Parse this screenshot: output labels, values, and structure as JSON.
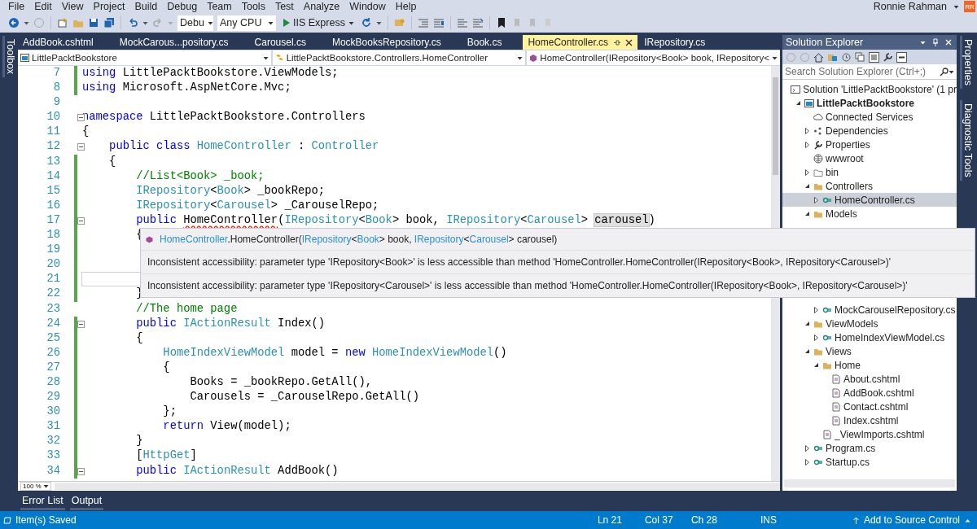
{
  "menu": {
    "items": [
      "File",
      "Edit",
      "View",
      "Project",
      "Build",
      "Debug",
      "Team",
      "Tools",
      "Test",
      "Analyze",
      "Window",
      "Help"
    ],
    "user": "Ronnie Rahman",
    "avatar": "RR"
  },
  "toolbar": {
    "configuration": "Debu",
    "platform": "Any CPU",
    "run": "IIS Express"
  },
  "toolbox_label": "Toolbox",
  "tabs": [
    {
      "label": "AddBook.cshtml",
      "selected": false
    },
    {
      "label": "MockCarous...pository.cs",
      "selected": false
    },
    {
      "label": "Carousel.cs",
      "selected": false
    },
    {
      "label": "MockBooksRepository.cs",
      "selected": false
    },
    {
      "label": "Book.cs",
      "selected": false
    },
    {
      "label": "HomeController.cs",
      "selected": true
    },
    {
      "label": "IRepository.cs",
      "selected": false
    }
  ],
  "navigation": {
    "project": "LittlePacktBookstore",
    "type": "LittlePacktBookstore.Controllers.HomeController",
    "member": "HomeController(IRepository<Book> book, IRepository<"
  },
  "editor": {
    "lines": [
      {
        "number": "7",
        "changed": true,
        "collapsible": false,
        "current": false,
        "tokens": [
          {
            "text": "using ",
            "kind": "keyword"
          },
          {
            "text": "LittlePacktBookstore.ViewModels;",
            "kind": "plain"
          }
        ]
      },
      {
        "number": "8",
        "changed": true,
        "collapsible": false,
        "current": false,
        "tokens": [
          {
            "text": "using ",
            "kind": "keyword"
          },
          {
            "text": "Microsoft.AspNetCore.Mvc;",
            "kind": "plain"
          }
        ]
      },
      {
        "number": "9",
        "changed": false,
        "collapsible": false,
        "current": false
      },
      {
        "number": "10",
        "changed": false,
        "collapsible": true,
        "current": false,
        "tokens": [
          {
            "text": "namespace ",
            "kind": "keyword"
          },
          {
            "text": "LittlePacktBookstore.Controllers",
            "kind": "plain"
          }
        ]
      },
      {
        "number": "11",
        "changed": false,
        "collapsible": false,
        "current": false,
        "tokens": [
          {
            "text": "{",
            "kind": "plain"
          }
        ]
      },
      {
        "number": "12",
        "changed": false,
        "collapsible": true,
        "current": false,
        "tokens": [
          {
            "text": "    public class ",
            "kind": "keyword"
          },
          {
            "text": "HomeController",
            "kind": "type"
          },
          {
            "text": " : ",
            "kind": "plain"
          },
          {
            "text": "Controller",
            "kind": "type"
          }
        ]
      },
      {
        "number": "13",
        "changed": true,
        "collapsible": false,
        "current": false,
        "tokens": [
          {
            "text": "    {",
            "kind": "plain"
          }
        ]
      },
      {
        "number": "14",
        "changed": true,
        "collapsible": false,
        "current": false,
        "tokens": [
          {
            "text": "        //List<Book> _book;",
            "kind": "comment"
          }
        ]
      },
      {
        "number": "15",
        "changed": true,
        "collapsible": false,
        "current": false,
        "tokens": [
          {
            "text": "        IRepository",
            "kind": "type"
          },
          {
            "text": "<",
            "kind": "plain"
          },
          {
            "text": "Book",
            "kind": "type"
          },
          {
            "text": "> _bookRepo;",
            "kind": "plain"
          }
        ]
      },
      {
        "number": "16",
        "changed": true,
        "collapsible": false,
        "current": false,
        "tokens": [
          {
            "text": "        IRepository",
            "kind": "type"
          },
          {
            "text": "<",
            "kind": "plain"
          },
          {
            "text": "Carousel",
            "kind": "type"
          },
          {
            "text": "> _CarouselRepo;",
            "kind": "plain"
          }
        ]
      },
      {
        "number": "17",
        "changed": true,
        "collapsible": true,
        "current": false,
        "tokens": [
          {
            "text": "        public ",
            "kind": "keyword"
          },
          {
            "text": "HomeController",
            "kind": "plain",
            "error": true
          },
          {
            "text": "(",
            "kind": "plain"
          },
          {
            "text": "IRepository",
            "kind": "type"
          },
          {
            "text": "<",
            "kind": "plain"
          },
          {
            "text": "Book",
            "kind": "type"
          },
          {
            "text": "> book, ",
            "kind": "plain"
          },
          {
            "text": "IRepository",
            "kind": "type"
          },
          {
            "text": "<",
            "kind": "plain"
          },
          {
            "text": "Carousel",
            "kind": "type"
          },
          {
            "text": "> ",
            "kind": "plain"
          },
          {
            "text": "carousel",
            "kind": "plain",
            "highlighted": true
          },
          {
            "text": ")",
            "kind": "plain"
          }
        ]
      },
      {
        "number": "18",
        "changed": true,
        "collapsible": false,
        "current": false,
        "tokens": [
          {
            "text": "        {",
            "kind": "plain"
          }
        ]
      },
      {
        "number": "19",
        "changed": true,
        "collapsible": false,
        "current": false
      },
      {
        "number": "20",
        "changed": true,
        "collapsible": false,
        "current": false
      },
      {
        "number": "21",
        "changed": true,
        "collapsible": false,
        "current": true
      },
      {
        "number": "22",
        "changed": true,
        "collapsible": false,
        "current": false,
        "tokens": [
          {
            "text": "        }",
            "kind": "plain"
          }
        ]
      },
      {
        "number": "23",
        "changed": false,
        "collapsible": false,
        "current": false,
        "tokens": [
          {
            "text": "        //The home page",
            "kind": "comment"
          }
        ]
      },
      {
        "number": "24",
        "changed": true,
        "collapsible": true,
        "current": false,
        "tokens": [
          {
            "text": "        public ",
            "kind": "keyword"
          },
          {
            "text": "IActionResult",
            "kind": "type"
          },
          {
            "text": " Index()",
            "kind": "plain"
          }
        ]
      },
      {
        "number": "25",
        "changed": true,
        "collapsible": false,
        "current": false,
        "tokens": [
          {
            "text": "        {",
            "kind": "plain"
          }
        ]
      },
      {
        "number": "26",
        "changed": true,
        "collapsible": false,
        "current": false,
        "tokens": [
          {
            "text": "            HomeIndexViewModel",
            "kind": "type"
          },
          {
            "text": " model = ",
            "kind": "plain"
          },
          {
            "text": "new ",
            "kind": "keyword"
          },
          {
            "text": "HomeIndexViewModel",
            "kind": "type"
          },
          {
            "text": "()",
            "kind": "plain"
          }
        ]
      },
      {
        "number": "27",
        "changed": true,
        "collapsible": false,
        "current": false,
        "tokens": [
          {
            "text": "            {",
            "kind": "plain"
          }
        ]
      },
      {
        "number": "28",
        "changed": true,
        "collapsible": false,
        "current": false,
        "tokens": [
          {
            "text": "                Books = _bookRepo.GetAll(),",
            "kind": "plain"
          }
        ]
      },
      {
        "number": "29",
        "changed": true,
        "collapsible": false,
        "current": false,
        "tokens": [
          {
            "text": "                Carousels = _CarouselRepo.GetAll()",
            "kind": "plain"
          }
        ]
      },
      {
        "number": "30",
        "changed": true,
        "collapsible": false,
        "current": false,
        "tokens": [
          {
            "text": "            };",
            "kind": "plain"
          }
        ]
      },
      {
        "number": "31",
        "changed": true,
        "collapsible": false,
        "current": false,
        "tokens": [
          {
            "text": "            return ",
            "kind": "keyword"
          },
          {
            "text": "View(model);",
            "kind": "plain"
          }
        ]
      },
      {
        "number": "32",
        "changed": true,
        "collapsible": false,
        "current": false,
        "tokens": [
          {
            "text": "        }",
            "kind": "plain"
          }
        ]
      },
      {
        "number": "33",
        "changed": true,
        "collapsible": false,
        "current": false,
        "tokens": [
          {
            "text": "        [",
            "kind": "plain"
          },
          {
            "text": "HttpGet",
            "kind": "type"
          },
          {
            "text": "]",
            "kind": "plain"
          }
        ]
      },
      {
        "number": "34",
        "changed": true,
        "collapsible": true,
        "current": false,
        "tokens": [
          {
            "text": "        public ",
            "kind": "keyword"
          },
          {
            "text": "IActionResult",
            "kind": "type"
          },
          {
            "text": " AddBook()",
            "kind": "plain"
          }
        ]
      }
    ],
    "zoom": "100 %"
  },
  "tooltip": {
    "signature": [
      {
        "text": "HomeController",
        "kind": "type"
      },
      {
        "text": ".HomeController(",
        "kind": "plain"
      },
      {
        "text": "IRepository",
        "kind": "type"
      },
      {
        "text": "<",
        "kind": "plain"
      },
      {
        "text": "Book",
        "kind": "type"
      },
      {
        "text": "> book, ",
        "kind": "plain"
      },
      {
        "text": "IRepository",
        "kind": "type"
      },
      {
        "text": "<",
        "kind": "plain"
      },
      {
        "text": "Carousel",
        "kind": "type"
      },
      {
        "text": "> carousel)",
        "kind": "plain"
      }
    ],
    "messages": [
      "Inconsistent accessibility: parameter type 'IRepository<Book>' is less accessible than method 'HomeController.HomeController(IRepository<Book>, IRepository<Carousel>)'",
      "Inconsistent accessibility: parameter type 'IRepository<Carousel>' is less accessible than method 'HomeController.HomeController(IRepository<Book>, IRepository<Carousel>)'"
    ]
  },
  "solution_explorer": {
    "title": "Solution Explorer",
    "search_placeholder": "Search Solution Explorer (Ctrl+;)",
    "tree": [
      {
        "label": "Solution 'LittlePacktBookstore' (1 pr",
        "kind": "solution",
        "selected": false,
        "children": [
          {
            "label": "LittlePacktBookstore",
            "kind": "project",
            "selected": false,
            "expanded": true,
            "children": [
              {
                "label": "Connected Services",
                "kind": "service",
                "selected": false
              },
              {
                "label": "Dependencies",
                "kind": "dependencies",
                "selected": false,
                "expanded": false
              },
              {
                "label": "Properties",
                "kind": "properties",
                "selected": false,
                "expanded": false
              },
              {
                "label": "wwwroot",
                "kind": "web",
                "selected": false
              },
              {
                "label": "bin",
                "kind": "excluded",
                "selected": false,
                "expanded": false
              },
              {
                "label": "Controllers",
                "kind": "folder",
                "selected": false,
                "expanded": true,
                "children": [
                  {
                    "label": "HomeController.cs",
                    "kind": "csharp",
                    "selected": true,
                    "expanded": false
                  }
                ]
              },
              {
                "label": "Models",
                "kind": "folder",
                "selected": false,
                "expanded": true,
                "children": [
                  {
                    "label": "MockCarouselRepository.cs",
                    "kind": "csharp",
                    "selected": false,
                    "expanded": false
                  }
                ]
              },
              {
                "label": "ViewModels",
                "kind": "folder",
                "selected": false,
                "expanded": true,
                "children": [
                  {
                    "label": "HomeIndexViewModel.cs",
                    "kind": "csharp",
                    "selected": false,
                    "expanded": false
                  }
                ]
              },
              {
                "label": "Views",
                "kind": "folder",
                "selected": false,
                "expanded": true,
                "children": [
                  {
                    "label": "Home",
                    "kind": "folder",
                    "selected": false,
                    "expanded": true,
                    "children": [
                      {
                        "label": "About.cshtml",
                        "kind": "page",
                        "selected": false
                      },
                      {
                        "label": "AddBook.cshtml",
                        "kind": "page",
                        "selected": false
                      },
                      {
                        "label": "Contact.cshtml",
                        "kind": "page",
                        "selected": false
                      },
                      {
                        "label": "Index.cshtml",
                        "kind": "page",
                        "selected": false
                      }
                    ]
                  },
                  {
                    "label": "_ViewImports.cshtml",
                    "kind": "page",
                    "selected": false
                  }
                ]
              },
              {
                "label": "Program.cs",
                "kind": "csharp",
                "selected": false,
                "expanded": false
              },
              {
                "label": "Startup.cs",
                "kind": "csharp",
                "selected": false,
                "expanded": false
              }
            ]
          }
        ]
      }
    ]
  },
  "side_tabs": [
    "Properties",
    "Diagnostic Tools"
  ],
  "bottom_tabs": [
    "Error List",
    "Output"
  ],
  "status_bar": {
    "message": "Item(s) Saved",
    "line": "Ln 21",
    "column": "Col 37",
    "char": "Ch 28",
    "mode": "INS",
    "source_control": "Add to Source Control"
  }
}
